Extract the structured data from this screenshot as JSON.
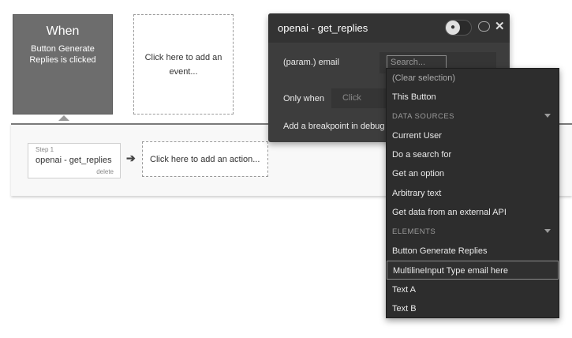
{
  "trigger": {
    "title": "When",
    "subtitle": "Button Generate Replies is clicked"
  },
  "event_placeholder": "Click here to add an event...",
  "steps": [
    {
      "label": "Step 1",
      "name": "openai - get_replies",
      "delete_label": "delete"
    }
  ],
  "action_placeholder": "Click here to add an action...",
  "property_panel": {
    "title": "openai - get_replies",
    "param_label": "(param.) email",
    "search_placeholder": "Search...",
    "only_when_label": "Only when",
    "only_when_placeholder": "Click",
    "breakpoint_label": "Add a breakpoint in debug mode"
  },
  "dropdown": {
    "clear": "(Clear selection)",
    "this_button": "This Button",
    "data_sources_header": "DATA SOURCES",
    "data_sources": [
      "Current User",
      "Do a search for",
      "Get an option",
      "Arbitrary text",
      "Get data from an external API"
    ],
    "elements_header": "ELEMENTS",
    "elements": [
      "Button Generate Replies",
      "MultilineInput Type email here",
      "Text A",
      "Text B"
    ],
    "selected_element": "MultilineInput Type email here"
  },
  "colors": {
    "trigger_bg": "#6d6d6d",
    "panel_bg": "#3d3d3d",
    "dropdown_bg": "#2d2d2d"
  }
}
